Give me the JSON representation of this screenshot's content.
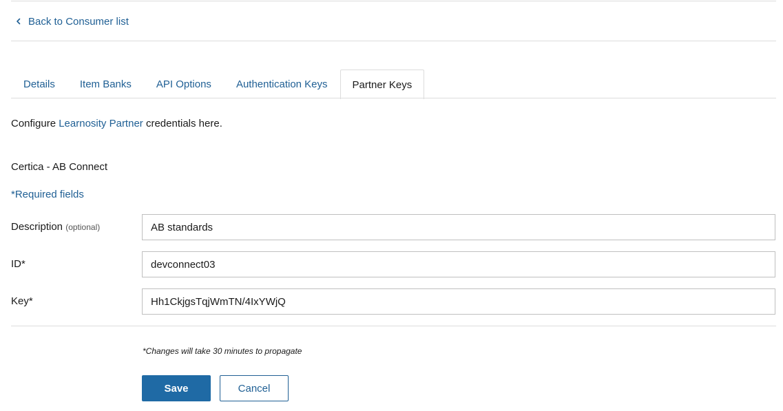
{
  "nav": {
    "back_label": "Back to Consumer list"
  },
  "tabs": [
    {
      "label": "Details",
      "active": false
    },
    {
      "label": "Item Banks",
      "active": false
    },
    {
      "label": "API Options",
      "active": false
    },
    {
      "label": "Authentication Keys",
      "active": false
    },
    {
      "label": "Partner Keys",
      "active": true
    }
  ],
  "intro": {
    "prefix": "Configure ",
    "link": "Learnosity Partner",
    "suffix": " credentials here."
  },
  "section": {
    "title": "Certica - AB Connect",
    "required_note": "*Required fields"
  },
  "form": {
    "description": {
      "label": "Description",
      "optional": "(optional)",
      "value": "AB standards"
    },
    "id": {
      "label": "ID*",
      "value": "devconnect03"
    },
    "key": {
      "label": "Key*",
      "value": "Hh1CkjgsTqjWmTN/4IxYWjQ"
    }
  },
  "footer": {
    "note": "*Changes will take 30 minutes to propagate",
    "save_label": "Save",
    "cancel_label": "Cancel"
  },
  "colors": {
    "link": "#1f5f94",
    "primary_button": "#1f6aa5",
    "divider": "#dcdcdc"
  },
  "icons": {
    "back": "chevron-left-icon"
  }
}
